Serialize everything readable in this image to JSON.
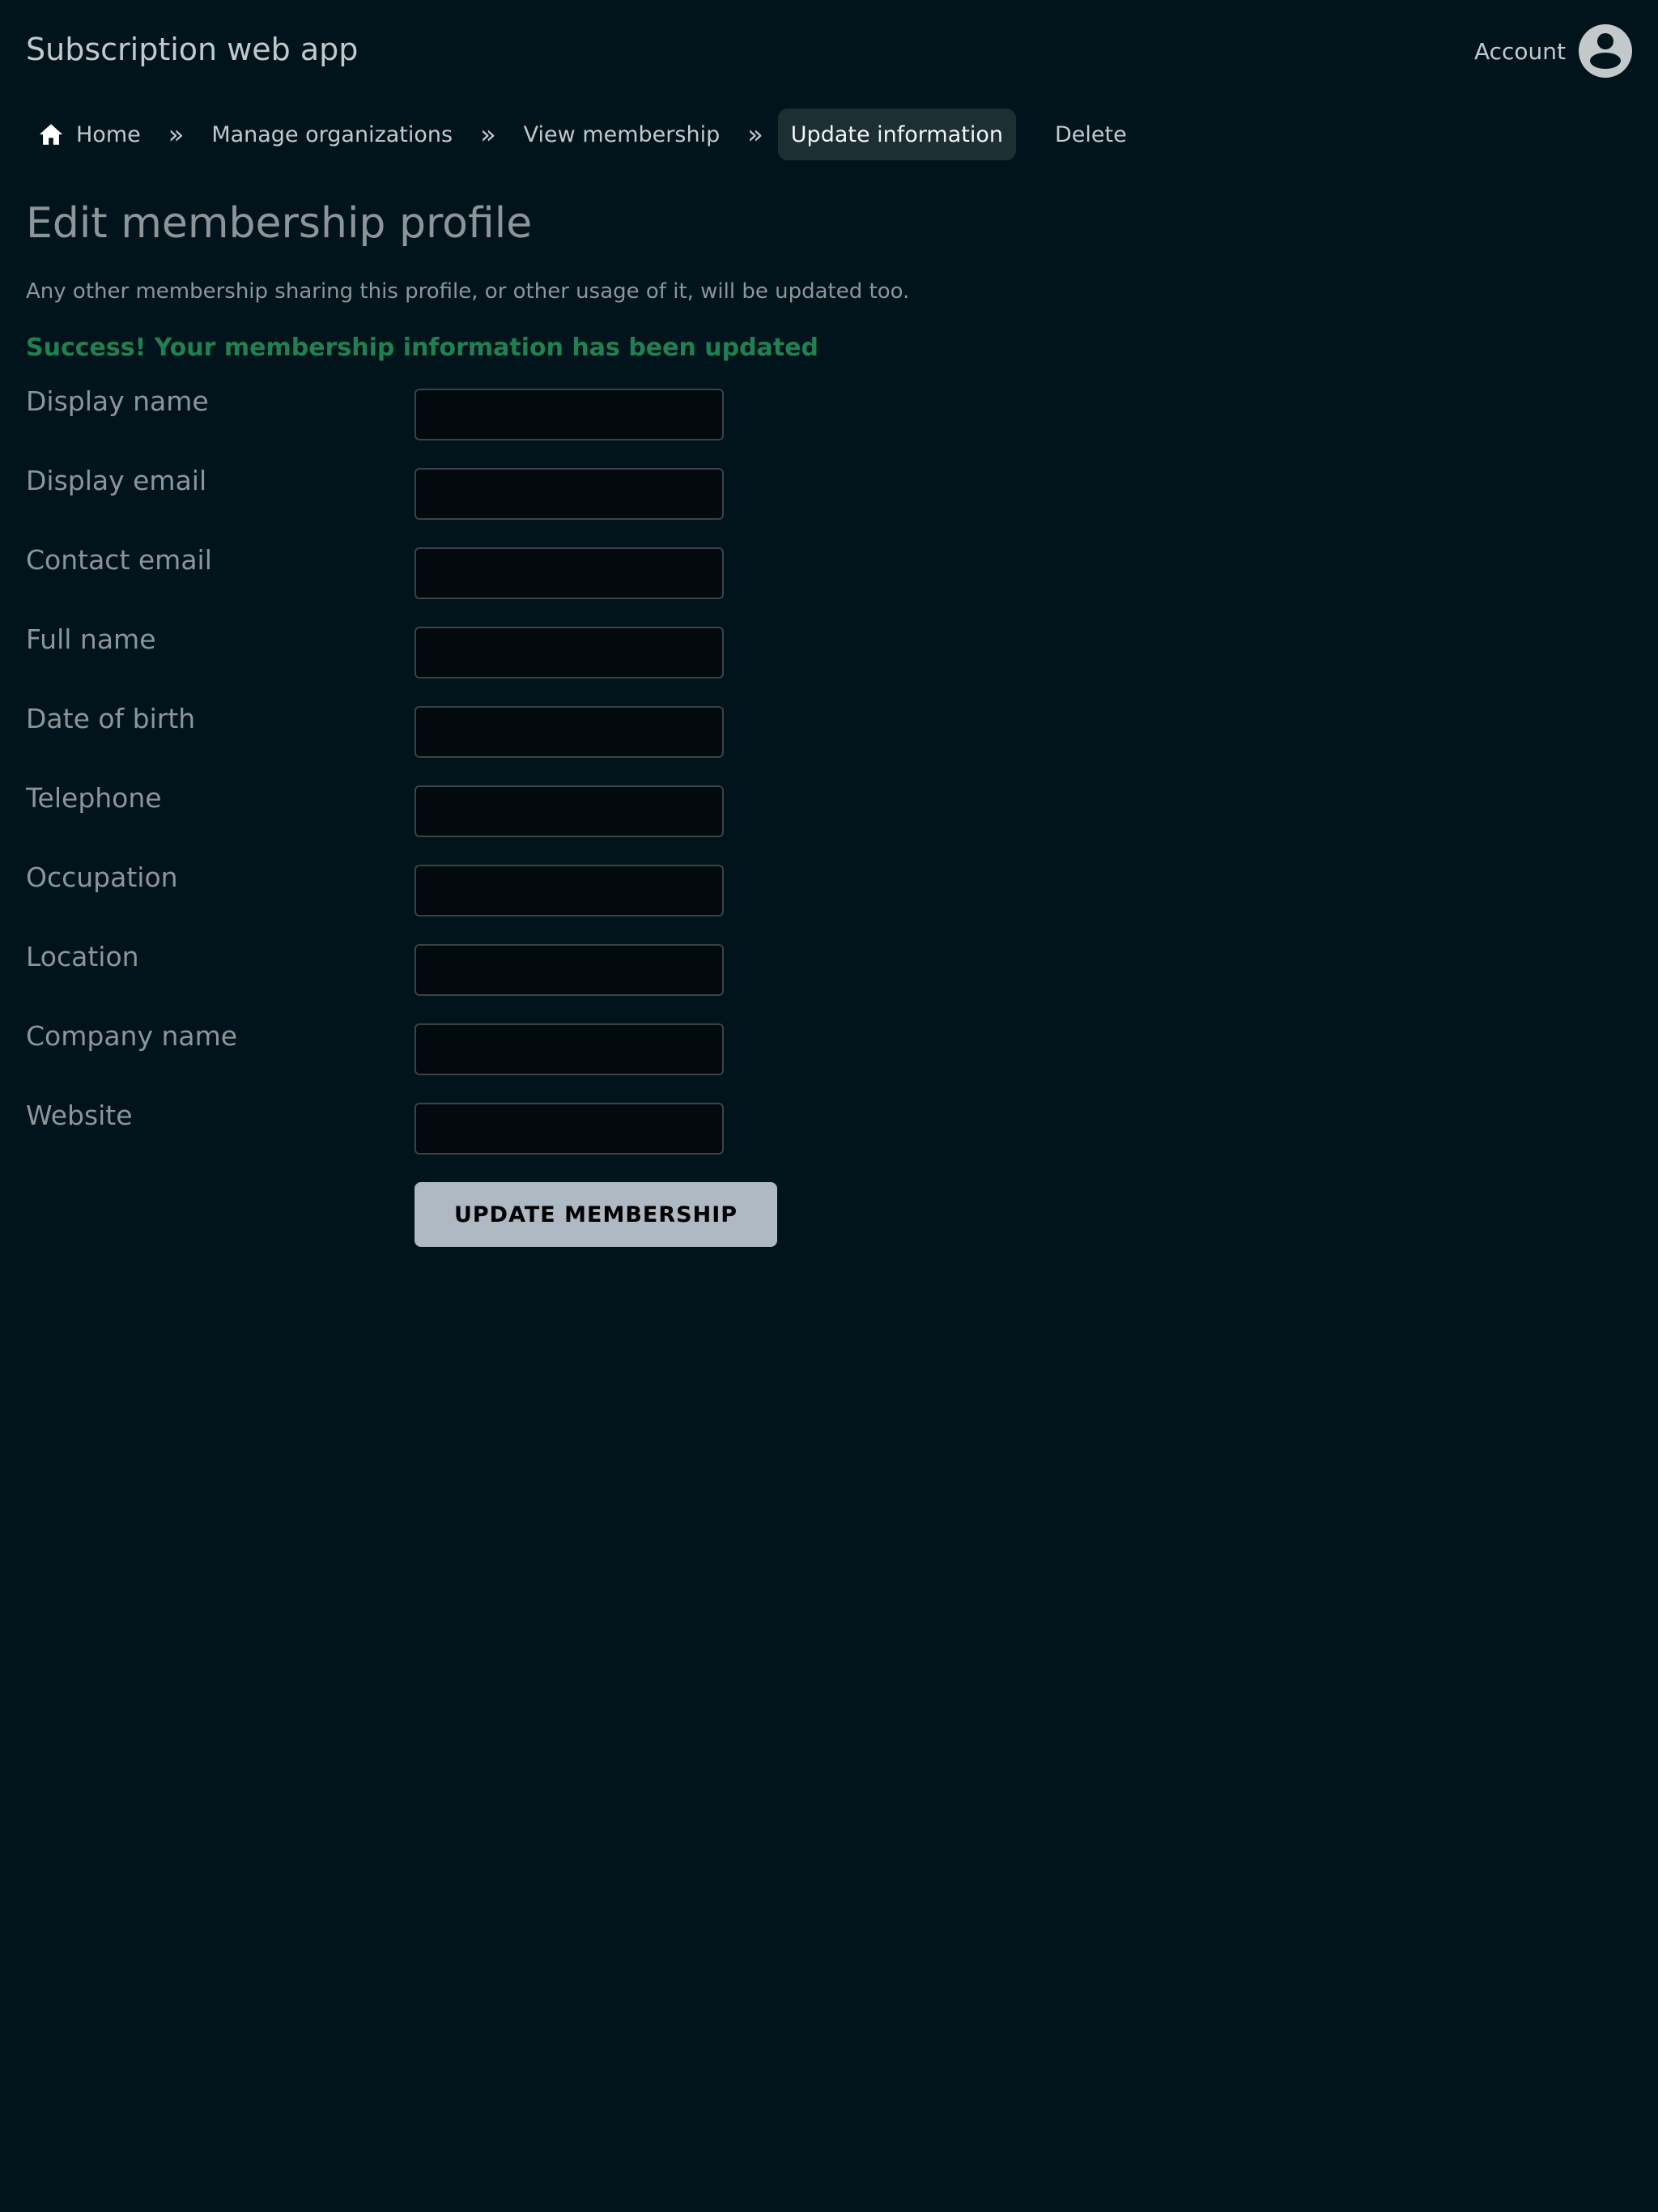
{
  "app": {
    "title": "Subscription web app"
  },
  "account": {
    "label": "Account",
    "icon": "user-circle-icon"
  },
  "breadcrumb": {
    "items": [
      {
        "label": "Home",
        "icon": "home-icon"
      },
      {
        "label": "Manage organizations"
      },
      {
        "label": "View membership"
      },
      {
        "label": "Update information",
        "active": true
      }
    ],
    "separator": "»",
    "delete_label": "Delete"
  },
  "page": {
    "title": "Edit membership profile",
    "description": "Any other membership sharing this profile, or other usage of it, will be updated too.",
    "success_message": "Success! Your membership information has been updated"
  },
  "form": {
    "fields": [
      {
        "label": "Display name",
        "value": ""
      },
      {
        "label": "Display email",
        "value": ""
      },
      {
        "label": "Contact email",
        "value": ""
      },
      {
        "label": "Full name",
        "value": ""
      },
      {
        "label": "Date of birth",
        "value": ""
      },
      {
        "label": "Telephone",
        "value": ""
      },
      {
        "label": "Occupation",
        "value": ""
      },
      {
        "label": "Location",
        "value": ""
      },
      {
        "label": "Company name",
        "value": ""
      },
      {
        "label": "Website",
        "value": ""
      }
    ],
    "submit_label": "UPDATE MEMBERSHIP"
  },
  "colors": {
    "background": "#01141b",
    "success": "#218052",
    "active_crumb": "#1c3033",
    "button": "#aeb9c3"
  }
}
